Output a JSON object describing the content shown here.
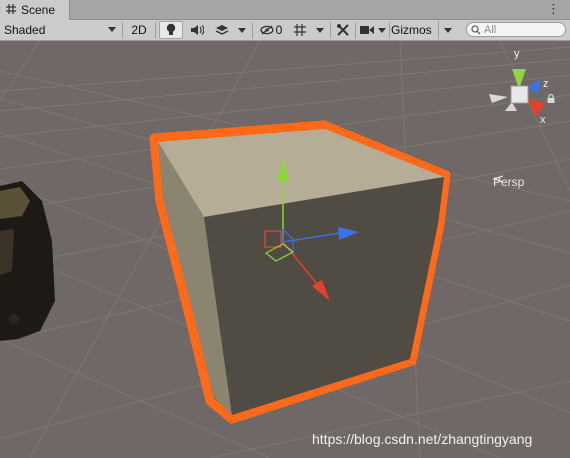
{
  "window": {
    "tab_label": "Scene",
    "tab_icon": "hash-grid-icon",
    "menu_icon": "kebab-menu-icon"
  },
  "toolbar": {
    "shading_mode": "Shaded",
    "mode_2d_label": "2D",
    "lighting_icon": "lightbulb-icon",
    "audio_icon": "speaker-icon",
    "effects_icon": "effects-layers-icon",
    "hidden_count": "0",
    "hidden_icon": "eye-slash-icon",
    "grid_icon": "grid-icon",
    "tools_icon": "crossed-tools-icon",
    "camera_icon": "video-camera-icon",
    "gizmos_label": "Gizmos",
    "search_placeholder": "All",
    "search_icon": "search-icon"
  },
  "viewport": {
    "projection_label": "Persp",
    "axis_labels": {
      "y": "y",
      "x": "x",
      "z": "z"
    },
    "selection_outline_color": "#ff6a1a",
    "axis_colors": {
      "x": "#e6402a",
      "y": "#8fd63a",
      "z": "#3b73e6"
    },
    "background_color": "#6f6866"
  },
  "watermark": "https://blog.csdn.net/zhangtingyang"
}
